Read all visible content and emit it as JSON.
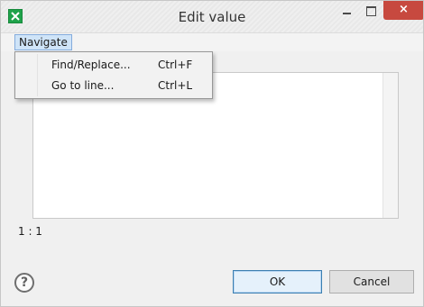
{
  "window": {
    "title": "Edit value",
    "close_label": "×"
  },
  "menubar": {
    "navigate_label": "Navigate"
  },
  "navigate_menu": {
    "items": [
      {
        "label": "Find/Replace...",
        "shortcut": "Ctrl+F"
      },
      {
        "label": "Go to line...",
        "shortcut": "Ctrl+L"
      }
    ]
  },
  "editor": {
    "value": "",
    "cursor_position": "1 : 1"
  },
  "footer": {
    "help_label": "?",
    "ok_label": "OK",
    "cancel_label": "Cancel"
  },
  "icons": {
    "app": "app-icon",
    "help": "help-icon",
    "minimize": "minimize-icon",
    "maximize": "maximize-icon",
    "close": "close-icon"
  },
  "colors": {
    "accent": "#84acdd",
    "close": "#c7493f",
    "app_icon": "#1fa24a"
  }
}
